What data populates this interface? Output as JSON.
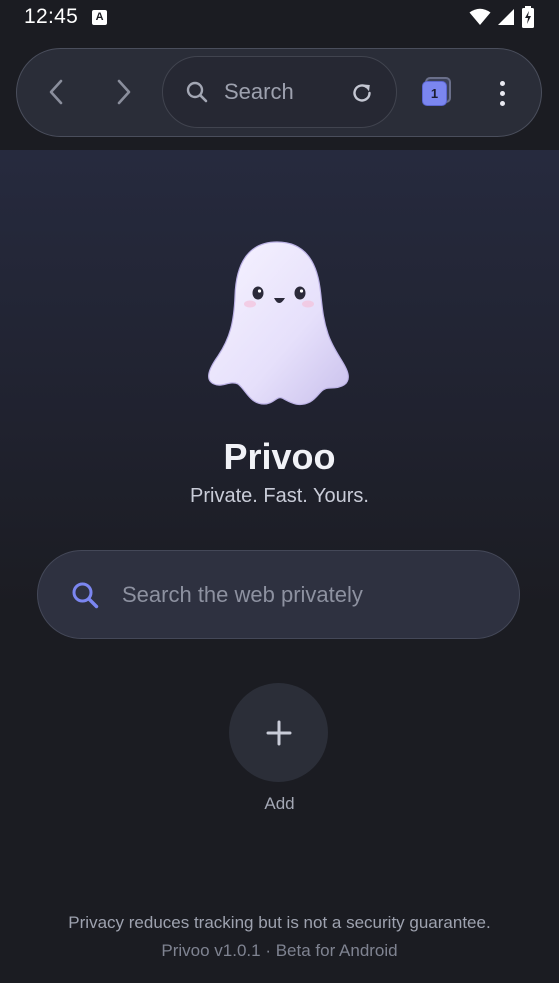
{
  "status_bar": {
    "time": "12:45",
    "notification_letter": "A",
    "icons": [
      "wifi-icon",
      "signal-icon",
      "battery-charging-icon"
    ]
  },
  "toolbar": {
    "back_icon": "chevron-left-icon",
    "forward_icon": "chevron-right-icon",
    "address": {
      "icon": "search-icon",
      "text": "Search",
      "reload_icon": "reload-icon"
    },
    "tab_count": "1",
    "menu_icon": "more-vertical-icon"
  },
  "home": {
    "mascot": "ghost-mascot",
    "app_name": "Privoo",
    "tagline": "Private. Fast. Yours.",
    "search": {
      "icon": "search-icon",
      "placeholder": "Search the web privately",
      "value": ""
    },
    "add_shortcut": {
      "icon": "plus-icon",
      "label": "Add"
    },
    "footer": {
      "disclaimer": "Privacy reduces tracking but is not a security guarantee.",
      "version": "Privoo v1.0.1 · Beta for Android"
    }
  },
  "colors": {
    "background": "#1b1c22",
    "toolbar": "#2a2d38",
    "accent": "#7b86f0",
    "search_icon_accent": "#7b86f0",
    "text_primary": "#f1f2f7",
    "text_secondary": "#9ea2af"
  }
}
